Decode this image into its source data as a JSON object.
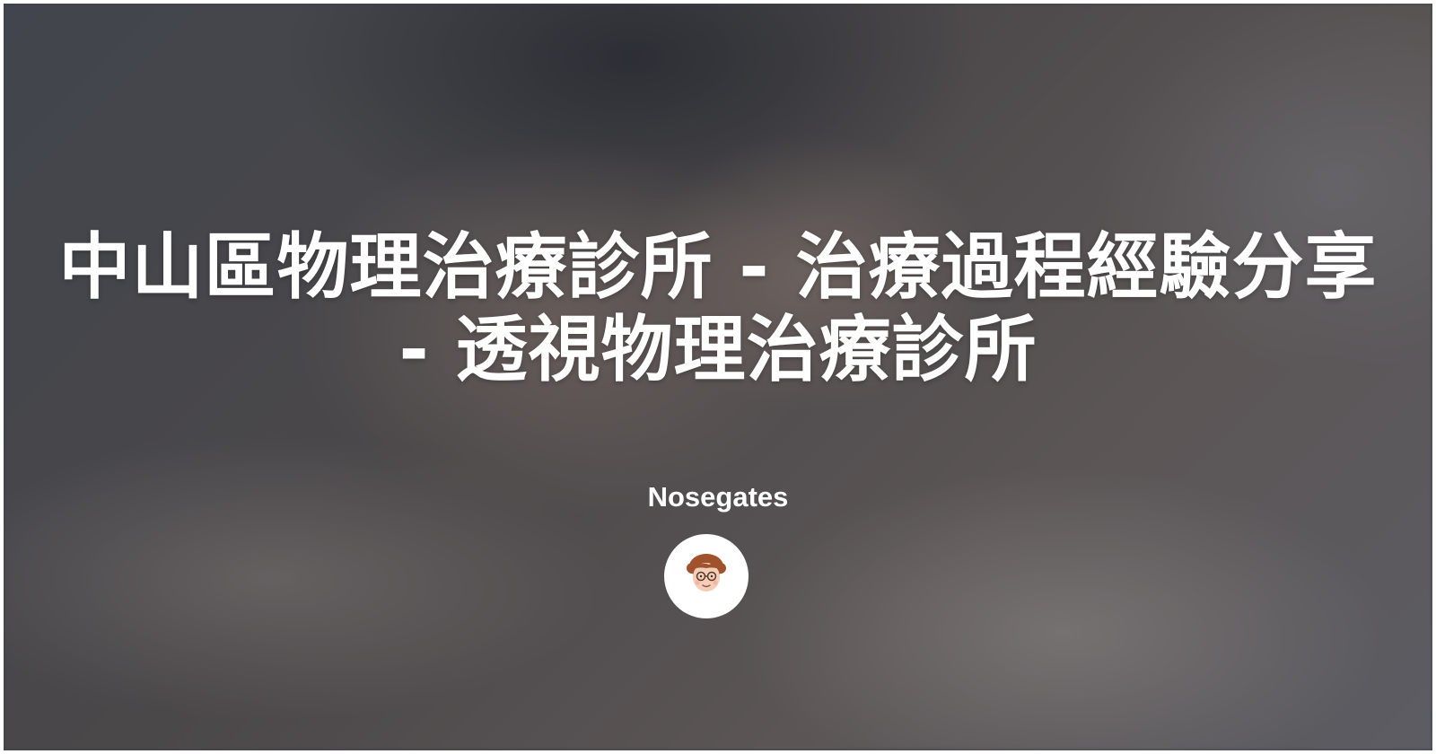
{
  "post": {
    "title": "中山區物理治療診所 - 治療過程經驗分享 - 透視物理治療診所",
    "author": "Nosegates"
  },
  "icons": {
    "avatar": "cartoon-face-icon"
  },
  "colors": {
    "text": "#ffffff",
    "avatar_background": "#ffffff"
  }
}
